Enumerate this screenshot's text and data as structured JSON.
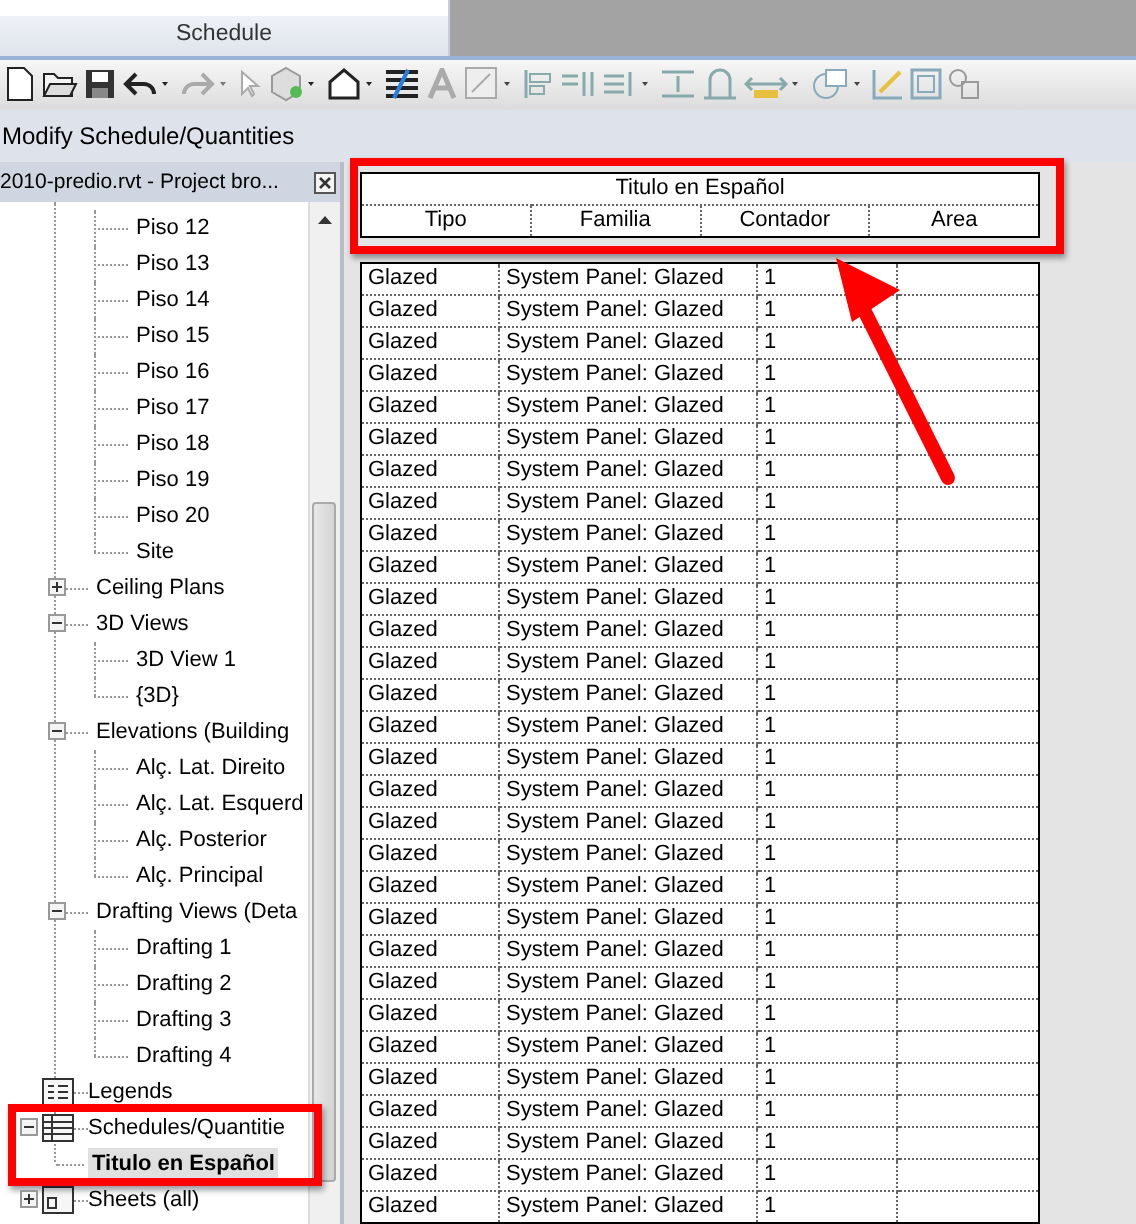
{
  "ribbon": {
    "panel_label": "Schedule"
  },
  "context_bar": {
    "title": "Modify Schedule/Quantities"
  },
  "browser": {
    "title": "2010-predio.rvt - Project bro...",
    "tree": [
      {
        "children": [
          {
            "label": "Piso 12"
          },
          {
            "label": "Piso 13"
          },
          {
            "label": "Piso 14"
          },
          {
            "label": "Piso 15"
          },
          {
            "label": "Piso 16"
          },
          {
            "label": "Piso 17"
          },
          {
            "label": "Piso 18"
          },
          {
            "label": "Piso 19"
          },
          {
            "label": "Piso 20"
          },
          {
            "label": "Site"
          }
        ]
      },
      {
        "label": "Ceiling Plans",
        "expanded": false
      },
      {
        "label": "3D Views",
        "expanded": true,
        "children": [
          {
            "label": "3D View 1"
          },
          {
            "label": "{3D}"
          }
        ]
      },
      {
        "label": "Elevations (Building",
        "expanded": true,
        "children": [
          {
            "label": "Alç. Lat. Direito"
          },
          {
            "label": "Alç. Lat. Esquerd"
          },
          {
            "label": "Alç. Posterior"
          },
          {
            "label": "Alç. Principal"
          }
        ]
      },
      {
        "label": "Drafting Views (Deta",
        "expanded": true,
        "children": [
          {
            "label": "Drafting 1"
          },
          {
            "label": "Drafting 2"
          },
          {
            "label": "Drafting 3"
          },
          {
            "label": "Drafting 4"
          }
        ]
      },
      {
        "label": "Legends",
        "kind": "legends"
      },
      {
        "label": "Schedules/Quantitie",
        "kind": "schedules",
        "expanded": true,
        "children": [
          {
            "label": "Titulo en Español",
            "selected": true
          }
        ]
      },
      {
        "label": "Sheets (all)",
        "kind": "sheets",
        "expanded": false
      }
    ]
  },
  "schedule": {
    "title": "Titulo en Español",
    "columns": [
      "Tipo",
      "Familia",
      "Contador",
      "Area"
    ],
    "rows": [
      [
        "Glazed",
        "System Panel: Glazed",
        "1"
      ],
      [
        "Glazed",
        "System Panel: Glazed",
        "1"
      ],
      [
        "Glazed",
        "System Panel: Glazed",
        "1"
      ],
      [
        "Glazed",
        "System Panel: Glazed",
        "1"
      ],
      [
        "Glazed",
        "System Panel: Glazed",
        "1"
      ],
      [
        "Glazed",
        "System Panel: Glazed",
        "1"
      ],
      [
        "Glazed",
        "System Panel: Glazed",
        "1"
      ],
      [
        "Glazed",
        "System Panel: Glazed",
        "1"
      ],
      [
        "Glazed",
        "System Panel: Glazed",
        "1"
      ],
      [
        "Glazed",
        "System Panel: Glazed",
        "1"
      ],
      [
        "Glazed",
        "System Panel: Glazed",
        "1"
      ],
      [
        "Glazed",
        "System Panel: Glazed",
        "1"
      ],
      [
        "Glazed",
        "System Panel: Glazed",
        "1"
      ],
      [
        "Glazed",
        "System Panel: Glazed",
        "1"
      ],
      [
        "Glazed",
        "System Panel: Glazed",
        "1"
      ],
      [
        "Glazed",
        "System Panel: Glazed",
        "1"
      ],
      [
        "Glazed",
        "System Panel: Glazed",
        "1"
      ],
      [
        "Glazed",
        "System Panel: Glazed",
        "1"
      ],
      [
        "Glazed",
        "System Panel: Glazed",
        "1"
      ],
      [
        "Glazed",
        "System Panel: Glazed",
        "1"
      ],
      [
        "Glazed",
        "System Panel: Glazed",
        "1"
      ],
      [
        "Glazed",
        "System Panel: Glazed",
        "1"
      ],
      [
        "Glazed",
        "System Panel: Glazed",
        "1"
      ],
      [
        "Glazed",
        "System Panel: Glazed",
        "1"
      ],
      [
        "Glazed",
        "System Panel: Glazed",
        "1"
      ],
      [
        "Glazed",
        "System Panel: Glazed",
        "1"
      ],
      [
        "Glazed",
        "System Panel: Glazed",
        "1"
      ],
      [
        "Glazed",
        "System Panel: Glazed",
        "1"
      ],
      [
        "Glazed",
        "System Panel: Glazed",
        "1"
      ],
      [
        "Glazed",
        "System Panel: Glazed",
        "1"
      ]
    ]
  }
}
